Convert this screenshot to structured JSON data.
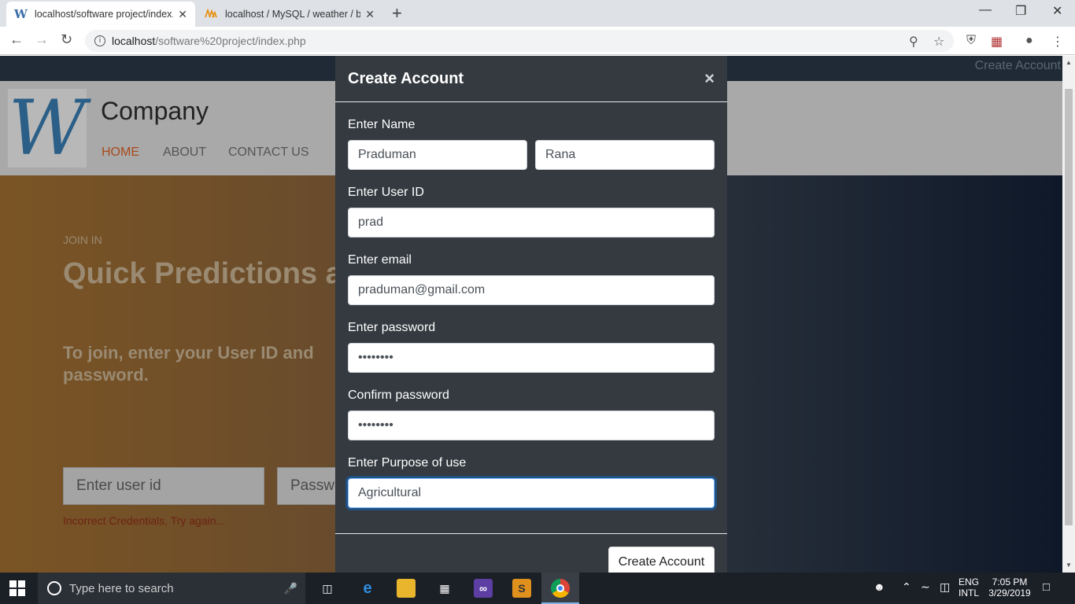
{
  "browser": {
    "tabs": [
      {
        "icon": "wordpress-icon",
        "title": "localhost/software project/index.php",
        "close": "✕"
      },
      {
        "icon": "phpmyadmin-icon",
        "title": "localhost / MySQL / weather / blog",
        "close": "✕"
      }
    ],
    "new_tab": "+",
    "url_host": "localhost",
    "url_path": "/software%20project/index.php"
  },
  "site": {
    "top_link": "Create Account",
    "company": "Company",
    "logo_letter": "W",
    "nav": [
      "HOME",
      "ABOUT",
      "CONTACT US"
    ],
    "join_in": "JOIN IN",
    "headline": "Quick Predictions a",
    "instructions": "To join, enter your User ID and password.",
    "user_id_placeholder": "Enter user id",
    "password_placeholder": "Passwo",
    "error": "Incorrect Credentials, Try again..."
  },
  "modal": {
    "title": "Create Account",
    "close": "×",
    "name_label": "Enter Name",
    "first_name": "Praduman",
    "last_name": "Rana",
    "userid_label": "Enter User ID",
    "userid": "prad",
    "email_label": "Enter email",
    "email": "praduman@gmail.com",
    "password_label": "Enter password",
    "password": "••••••••",
    "confirm_label": "Confirm password",
    "confirm": "••••••••",
    "purpose_label": "Enter Purpose of use",
    "purpose": "Agricultural",
    "submit": "Create Account"
  },
  "taskbar": {
    "search_placeholder": "Type here to search",
    "lang_top": "ENG",
    "lang_bottom": "INTL",
    "time": "7:05 PM",
    "date": "3/29/2019"
  },
  "colors": {
    "modal_bg": "#343a40",
    "nav_active": "#a84a1b",
    "error": "#6e2214",
    "focus": "#80bdff"
  }
}
